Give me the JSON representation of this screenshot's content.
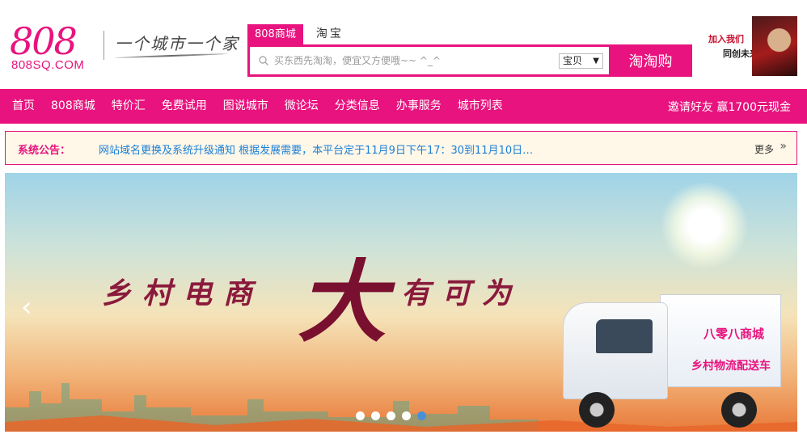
{
  "logo": {
    "number": "808",
    "domain": "808SQ.COM",
    "slogan": "一个城市一个家"
  },
  "search": {
    "tabs": [
      {
        "label": "808商城",
        "active": true
      },
      {
        "label": "淘宝",
        "active": false
      }
    ],
    "placeholder": "买东西先淘淘，便宜又方便哦~~ ^_^",
    "scope": "宝贝",
    "button": "淘淘购"
  },
  "promo": {
    "line1": "加入我们",
    "line2": "同创未来"
  },
  "nav": {
    "items": [
      "首页",
      "808商城",
      "特价汇",
      "免费试用",
      "图说城市",
      "微论坛",
      "分类信息",
      "办事服务",
      "城市列表"
    ],
    "right": "邀请好友 赢1700元现金"
  },
  "notice": {
    "label": "系统公告：",
    "text": "网站域名更换及系统升级通知 根据发展需要，本平台定于11月9日下午17：30到11月10日…",
    "more": "更多"
  },
  "banner": {
    "headline_left": "乡村电商",
    "headline_big": "大",
    "headline_right": "有可为",
    "truck_line1": "八零八商城",
    "truck_line2": "乡村物流配送车",
    "slide_count": 5,
    "active_slide": 5
  },
  "colors": {
    "brand": "#e8137e",
    "link": "#1a7fd6",
    "notice_bg": "#fff7e8"
  }
}
